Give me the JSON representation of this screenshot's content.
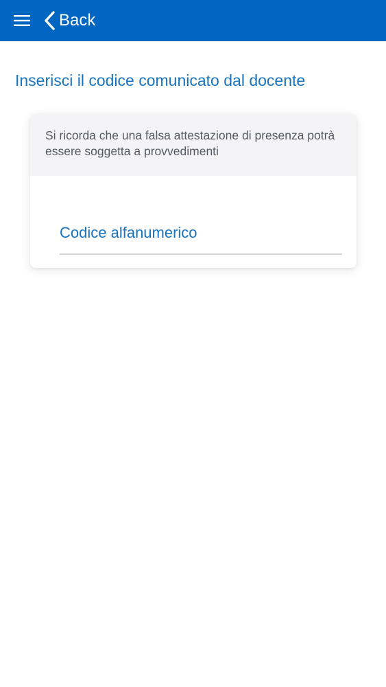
{
  "header": {
    "back_label": "Back",
    "menu_icon": "hamburger-menu-icon",
    "back_icon": "chevron-left-icon",
    "color": "#0066c2"
  },
  "page": {
    "title": "Inserisci il codice comunicato dal docente"
  },
  "card": {
    "notice_text": "Si ricorda che una falsa attestazione di presenza potrà essere soggetta a provvedimenti",
    "code_input": {
      "placeholder": "Codice alfanumerico",
      "value": ""
    }
  },
  "colors": {
    "accent": "#1a73bd",
    "notice_background": "#f4f3f6"
  }
}
